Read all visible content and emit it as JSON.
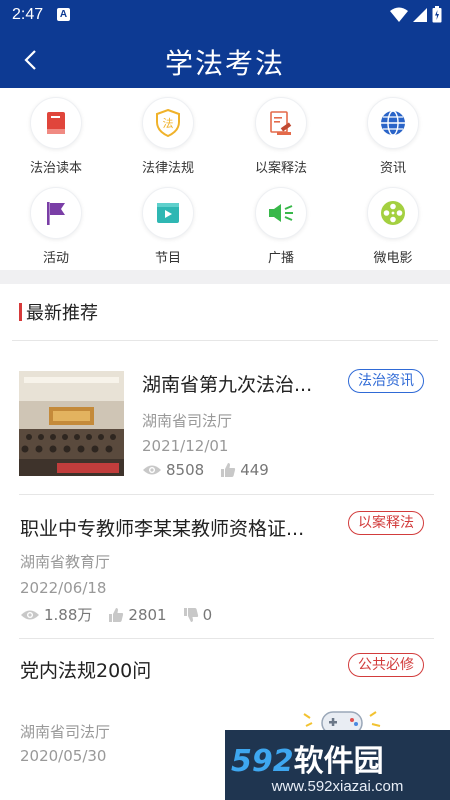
{
  "status_bar": {
    "time": "2:47",
    "notification_badge": "A"
  },
  "header": {
    "title": "学法考法"
  },
  "grid": [
    {
      "label": "法治读本",
      "icon": "book-icon",
      "color": "#e0453b"
    },
    {
      "label": "法律法规",
      "icon": "shield-law-icon",
      "color": "#f0b22a"
    },
    {
      "label": "以案释法",
      "icon": "gavel-document-icon",
      "color": "#e46a4a"
    },
    {
      "label": "资讯",
      "icon": "globe-icon",
      "color": "#2a64c8"
    },
    {
      "label": "活动",
      "icon": "flag-icon",
      "color": "#7a3ea6"
    },
    {
      "label": "节目",
      "icon": "video-play-icon",
      "color": "#2fb7b3"
    },
    {
      "label": "广播",
      "icon": "speaker-icon",
      "color": "#38b84a"
    },
    {
      "label": "微电影",
      "icon": "film-reel-icon",
      "color": "#a4d040"
    }
  ],
  "section": {
    "title": "最新推荐"
  },
  "articles": [
    {
      "title": "湖南省第九次法治...",
      "tag": "法治资讯",
      "source": "湖南省司法厅",
      "date": "2021/12/01",
      "views": "8508",
      "likes": "449"
    },
    {
      "title": "职业中专教师李某某教师资格证...",
      "tag": "以案释法",
      "source": "湖南省教育厅",
      "date": "2022/06/18",
      "views": "1.88万",
      "likes": "2801",
      "dislikes": "0"
    },
    {
      "title": "党内法规200问",
      "tag": "公共必修",
      "source": "湖南省司法厅",
      "date": "2020/05/30"
    }
  ],
  "watermark": {
    "brand": "592",
    "brand_cn": "软件园",
    "url": "www.592xiazai.com"
  },
  "colors": {
    "header_bg": "#0d3a93",
    "accent_red": "#d63a3a",
    "tag_blue": "#2f6ad6"
  }
}
